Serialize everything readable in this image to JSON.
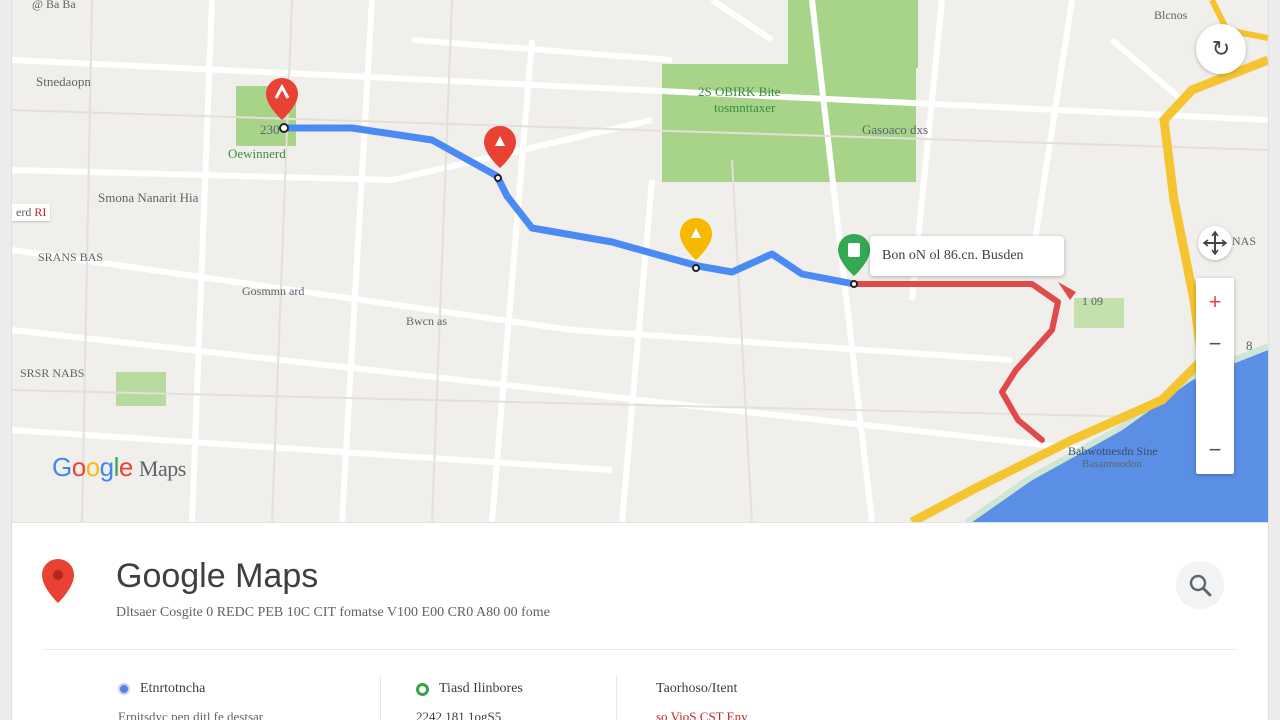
{
  "map": {
    "labels": {
      "top_left": "@ Ba Ba",
      "place_1": "Stnedaopn",
      "place_2": "Smona Nanarit Hia",
      "park_a": "Oewinnerd",
      "park_a_num": "230",
      "park_b_line1": "2S OBIRK Bite",
      "park_b_line2": "tosmnttaxer",
      "area_c": "Gasoaco dxs",
      "road_1": "SRANS BAS",
      "road_2": "Gosmmn ard",
      "road_3": "Bwcn as",
      "road_4": "SRSR NABS",
      "badge_left": "RI",
      "badge_left_prefix": "erd",
      "right_num": "1 09",
      "shore_label": "Babwotnesdn Sine",
      "shore_sub": "Basannoodon",
      "edge_num": "8",
      "top_right_small": "Blcnos",
      "right_pan": "NAS"
    },
    "callout": "Bon oN ol 86.cn. Busden",
    "logo": {
      "google": "Google",
      "maps": "Maps"
    },
    "markers": [
      "start-marker",
      "waypoint-marker-red",
      "waypoint-marker-yellow",
      "destination-marker-green"
    ],
    "colors": {
      "route_blue": "#4a8af4",
      "route_red": "#e04a4a",
      "road_yellow": "#f5c431",
      "water": "#5b8fe6",
      "park": "#a8d48a"
    }
  },
  "controls": {
    "zoom_in": "+",
    "zoom_out": "−",
    "zoom_out_2": "−"
  },
  "panel": {
    "title": "Google Maps",
    "subtitle": "Dltsaer Cosgite 0 REDC PEB 10C CIT fomatse V100 E00 CR0 A80 00 fome",
    "stats": [
      {
        "label": "Etnrtotncha",
        "value": "Erpitsdyc pen ditl fe destsar",
        "dot": "#5b7fe0"
      },
      {
        "label": "Tiasd Ilinbores",
        "value": "2242 181   1ogS5",
        "dot": "#3aa14a"
      },
      {
        "label": "Taorhoso/Itent",
        "value": "so VioS CST Eny",
        "dot": ""
      }
    ]
  }
}
